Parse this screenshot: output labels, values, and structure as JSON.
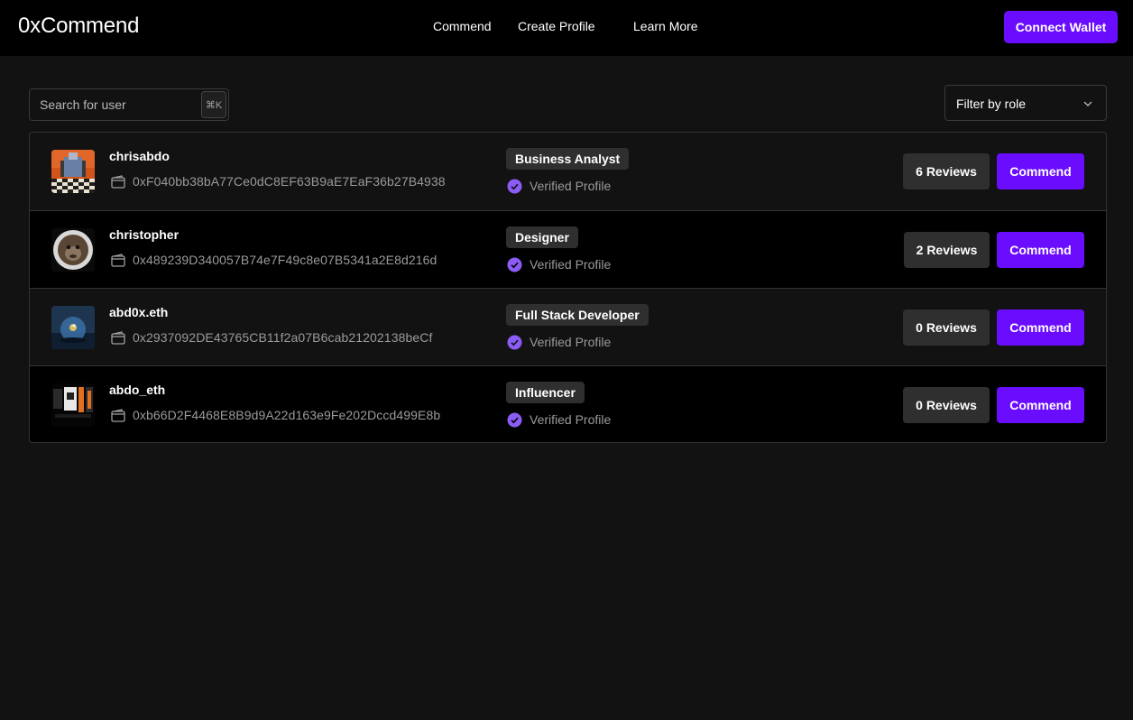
{
  "app": {
    "brand": "0xCommend"
  },
  "nav": {
    "links": [
      "Commend",
      "Create Profile",
      "Learn More"
    ],
    "connect_wallet": "Connect Wallet"
  },
  "search": {
    "placeholder": "Search for user",
    "shortcut": "⌘K"
  },
  "filter": {
    "label": "Filter by role"
  },
  "users": [
    {
      "username": "chrisabdo",
      "address": "0xF040bb38bA77Ce0dC8EF63B9aE7EaF36b27B4938",
      "role": "Business Analyst",
      "verified": "Verified Profile",
      "reviews": "6 Reviews",
      "action": "Commend"
    },
    {
      "username": "christopher",
      "address": "0x489239D340057B74e7F49c8e07B5341a2E8d216d",
      "role": "Designer",
      "verified": "Verified Profile",
      "reviews": "2 Reviews",
      "action": "Commend"
    },
    {
      "username": "abd0x.eth",
      "address": "0x2937092DE43765CB11f2a07B6cab21202138beCf",
      "role": "Full Stack Developer",
      "verified": "Verified Profile",
      "reviews": "0 Reviews",
      "action": "Commend"
    },
    {
      "username": "abdo_eth",
      "address": "0xb66D2F4468E8B9d9A22d163e9Fe202Dccd499E8b",
      "role": "Influencer",
      "verified": "Verified Profile",
      "reviews": "0 Reviews",
      "action": "Commend"
    }
  ],
  "colors": {
    "accent": "#6a0dff",
    "background": "#121212",
    "navbar": "#000000",
    "badge": "#2f2f2f",
    "verified": "#8b5cf6"
  },
  "icons": {
    "wallet": "wallet-icon",
    "verified": "verified-check-icon",
    "chevron": "chevron-down-icon"
  }
}
